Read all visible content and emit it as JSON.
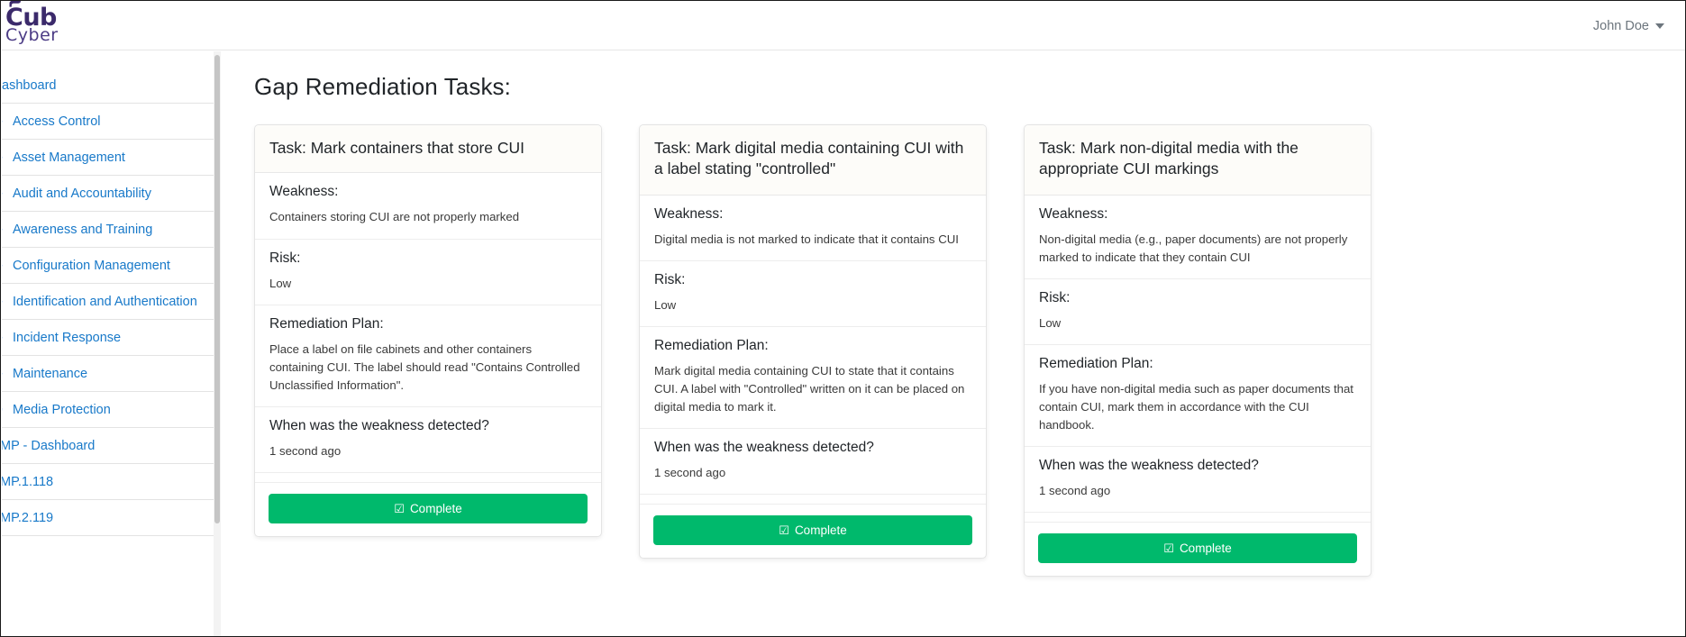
{
  "brand": {
    "line1": "Cub",
    "line2": "Cyber",
    "color": "#3b2a6b"
  },
  "header": {
    "user_name": "John Doe",
    "caret_icon": "chevron-down-icon"
  },
  "sidebar": {
    "items": [
      {
        "label": "ashboard",
        "type": "dashboard",
        "chevron": "",
        "expanded": false
      },
      {
        "label": "Access Control",
        "type": "group",
        "chevron": "›",
        "expanded": false
      },
      {
        "label": "Asset Management",
        "type": "group",
        "chevron": "›",
        "expanded": false
      },
      {
        "label": "Audit and Accountability",
        "type": "group",
        "chevron": "›",
        "expanded": false
      },
      {
        "label": "Awareness and Training",
        "type": "group",
        "chevron": "›",
        "expanded": false
      },
      {
        "label": "Configuration Management",
        "type": "group",
        "chevron": "›",
        "expanded": false
      },
      {
        "label": "Identification and Authentication",
        "type": "group",
        "chevron": "›",
        "expanded": false
      },
      {
        "label": "Incident Response",
        "type": "group",
        "chevron": "›",
        "expanded": false
      },
      {
        "label": "Maintenance",
        "type": "group",
        "chevron": "›",
        "expanded": false
      },
      {
        "label": "Media Protection",
        "type": "group",
        "chevron": "›",
        "expanded": true
      },
      {
        "label": "MP - Dashboard",
        "type": "sub",
        "chevron": "",
        "expanded": false
      },
      {
        "label": "MP.1.118",
        "type": "sub",
        "chevron": "",
        "expanded": false
      },
      {
        "label": "MP.2.119",
        "type": "sub",
        "chevron": "",
        "expanded": false
      }
    ]
  },
  "main": {
    "page_title": "Gap Remediation Tasks:",
    "labels": {
      "weakness": "Weakness:",
      "risk": "Risk:",
      "remediation": "Remediation Plan:",
      "detected": "When was the weakness detected?",
      "complete": "Complete"
    },
    "cards": [
      {
        "title": "Task: Mark containers that store CUI",
        "weakness": "Containers storing CUI are not properly marked",
        "risk": "Low",
        "remediation": "Place a label on file cabinets and other containers containing CUI. The label should read \"Contains Controlled Unclassified Information\".",
        "detected": "1 second ago",
        "complete_label": "Complete"
      },
      {
        "title": "Task: Mark digital media containing CUI with a label stating \"controlled\"",
        "weakness": "Digital media is not marked to indicate that it contains CUI",
        "risk": "Low",
        "remediation": "Mark digital media containing CUI to state that it contains CUI. A label with \"Controlled\" written on it can be placed on digital media to mark it.",
        "detected": "1 second ago",
        "complete_label": "Complete"
      },
      {
        "title": "Task: Mark non-digital media with the appropriate CUI markings",
        "weakness": "Non-digital media (e.g., paper documents) are not properly marked to indicate that they contain CUI",
        "risk": "Low",
        "remediation": "If you have non-digital media such as paper documents that contain CUI, mark them in accordance with the CUI handbook.",
        "detected": "1 second ago",
        "complete_label": "Complete"
      }
    ]
  },
  "colors": {
    "link": "#1879c9",
    "success": "#00b96c",
    "card_header_bg": "#fdfcf9"
  }
}
